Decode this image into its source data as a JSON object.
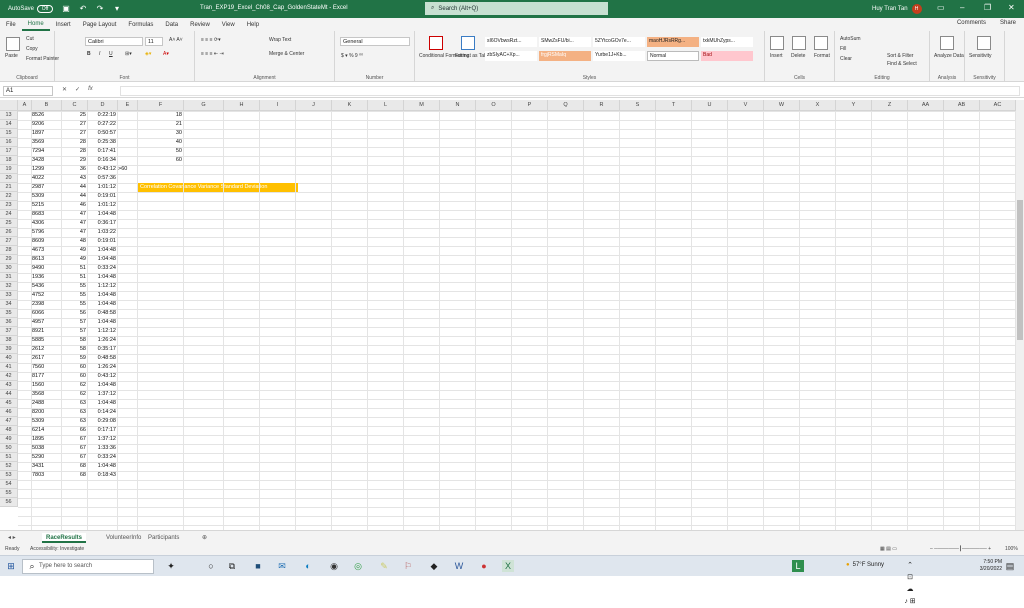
{
  "titlebar": {
    "autosave_label": "AutoSave",
    "autosave_state": "Off",
    "filename": "Tran_EXP19_Excel_Ch08_Cap_GoldenStateMt - Excel",
    "search_placeholder": "Search (Alt+Q)",
    "user_name": "Huy Tran Tan",
    "user_initials": "H"
  },
  "menu": {
    "tabs": [
      "File",
      "Home",
      "Insert",
      "Page Layout",
      "Formulas",
      "Data",
      "Review",
      "View",
      "Help"
    ],
    "active_tab": "Home",
    "comments": "Comments",
    "share": "Share"
  },
  "ribbon": {
    "clipboard": {
      "paste": "Paste",
      "cut": "Cut",
      "copy": "Copy",
      "format_painter": "Format Painter",
      "label": "Clipboard"
    },
    "font": {
      "font_name": "Calibri",
      "font_size": "11",
      "bold": "B",
      "italic": "I",
      "underline": "U",
      "label": "Font"
    },
    "alignment": {
      "wrap": "Wrap Text",
      "merge": "Merge & Center",
      "label": "Alignment"
    },
    "number": {
      "format": "General",
      "label": "Number"
    },
    "styles": {
      "conditional": "Conditional Formatting",
      "format_as_table": "Format as Table",
      "items": [
        "sI6OVbwsRzt...",
        "SMwZsFU/bi...",
        "5ZYtcoGOv7e...",
        "maoHJRsRRg...",
        "txkMUhZyps...",
        "frgjRSMaIq",
        "Yurbe1J+Kb...",
        "Normal",
        "Bad",
        "zbSIyAC+Xp..."
      ],
      "label": "Styles"
    },
    "cells": {
      "insert": "Insert",
      "delete": "Delete",
      "format": "Format",
      "label": "Cells"
    },
    "editing": {
      "autosum": "AutoSum",
      "fill": "Fill",
      "clear": "Clear",
      "sort": "Sort & Filter",
      "find": "Find & Select",
      "label": "Editing"
    },
    "analysis": {
      "analyze": "Analyze Data",
      "label": "Analysis"
    },
    "sensitivity": {
      "label": "Sensitivity",
      "button": "Sensitivity"
    }
  },
  "formula_bar": {
    "name_box": "A1",
    "fx": "fx",
    "value": ""
  },
  "columns": [
    "A",
    "B",
    "C",
    "D",
    "E",
    "F",
    "G",
    "H",
    "I",
    "J",
    "K",
    "L",
    "M",
    "N",
    "O",
    "P",
    "Q",
    "R",
    "S",
    "T",
    "U",
    "V",
    "W",
    "X",
    "Y",
    "Z",
    "AA",
    "AB",
    "AC",
    "AD"
  ],
  "rows": [
    "13",
    "14",
    "15",
    "16",
    "17",
    "18",
    "19",
    "20",
    "21",
    "22",
    "23",
    "24",
    "25",
    "26",
    "27",
    "28",
    "29",
    "30",
    "31",
    "32",
    "33",
    "34",
    "35",
    "36",
    "37",
    "38",
    "39",
    "40",
    "41",
    "42",
    "43",
    "44",
    "45",
    "46",
    "47",
    "48",
    "49",
    "50",
    "51",
    "52",
    "53",
    "54",
    "55",
    "56"
  ],
  "data_rows": [
    [
      "8526",
      "25",
      "0:22:19"
    ],
    [
      "9206",
      "27",
      "0:27:22"
    ],
    [
      "1897",
      "27",
      "0:50:57"
    ],
    [
      "3569",
      "28",
      "0:25:38"
    ],
    [
      "7294",
      "28",
      "0:17:41"
    ],
    [
      "3428",
      "29",
      "0:16:34"
    ],
    [
      "1299",
      "36",
      "0:43:12"
    ],
    [
      "4022",
      "43",
      "0:57:36"
    ],
    [
      "2987",
      "44",
      "1:01:12"
    ],
    [
      "5309",
      "44",
      "0:19:01"
    ],
    [
      "5215",
      "46",
      "1:01:12"
    ],
    [
      "8683",
      "47",
      "1:04:48"
    ],
    [
      "4306",
      "47",
      "0:36:17"
    ],
    [
      "5796",
      "47",
      "1:03:22"
    ],
    [
      "8609",
      "48",
      "0:19:01"
    ],
    [
      "4673",
      "49",
      "1:04:48"
    ],
    [
      "8613",
      "49",
      "1:04:48"
    ],
    [
      "9490",
      "51",
      "0:33:24"
    ],
    [
      "1936",
      "51",
      "1:04:48"
    ],
    [
      "5436",
      "55",
      "1:12:12"
    ],
    [
      "4752",
      "55",
      "1:04:48"
    ],
    [
      "2398",
      "55",
      "1:04:48"
    ],
    [
      "6066",
      "56",
      "0:48:58"
    ],
    [
      "4957",
      "57",
      "1:04:48"
    ],
    [
      "8921",
      "57",
      "1:12:12"
    ],
    [
      "5885",
      "58",
      "1:26:24"
    ],
    [
      "2612",
      "58",
      "0:35:17"
    ],
    [
      "2617",
      "59",
      "0:48:58"
    ],
    [
      "7560",
      "60",
      "1:26:24"
    ],
    [
      "8177",
      "60",
      "0:43:12"
    ],
    [
      "1560",
      "62",
      "1:04:48"
    ],
    [
      "3568",
      "62",
      "1:37:12"
    ],
    [
      "2488",
      "63",
      "1:04:48"
    ],
    [
      "8200",
      "63",
      "0:14:24"
    ],
    [
      "5309",
      "63",
      "0:29:08"
    ],
    [
      "6214",
      "66",
      "0:17:17"
    ],
    [
      "1895",
      "67",
      "1:37:12"
    ],
    [
      "5038",
      "67",
      "1:33:36"
    ],
    [
      "5290",
      "67",
      "0:33:24"
    ],
    [
      "3431",
      "68",
      "1:04:48"
    ],
    [
      "7803",
      "68",
      "0:18:43"
    ]
  ],
  "f_values": [
    "18",
    "21",
    "30",
    "40",
    "50",
    "60"
  ],
  "e_label": ">60",
  "stats_header": "Correlation  Covariance  Variance  Standard Deviation",
  "sheet_tabs": [
    "RaceResults",
    "VolunteerInfo",
    "Participants"
  ],
  "active_sheet": "RaceResults",
  "status": {
    "ready": "Ready",
    "accessibility": "Accessibility: Investigate",
    "zoom": "100%"
  },
  "taskbar": {
    "search_placeholder": "Type here to search",
    "weather": "57°F  Sunny",
    "time": "7:50 PM",
    "date": "3/20/2022"
  }
}
